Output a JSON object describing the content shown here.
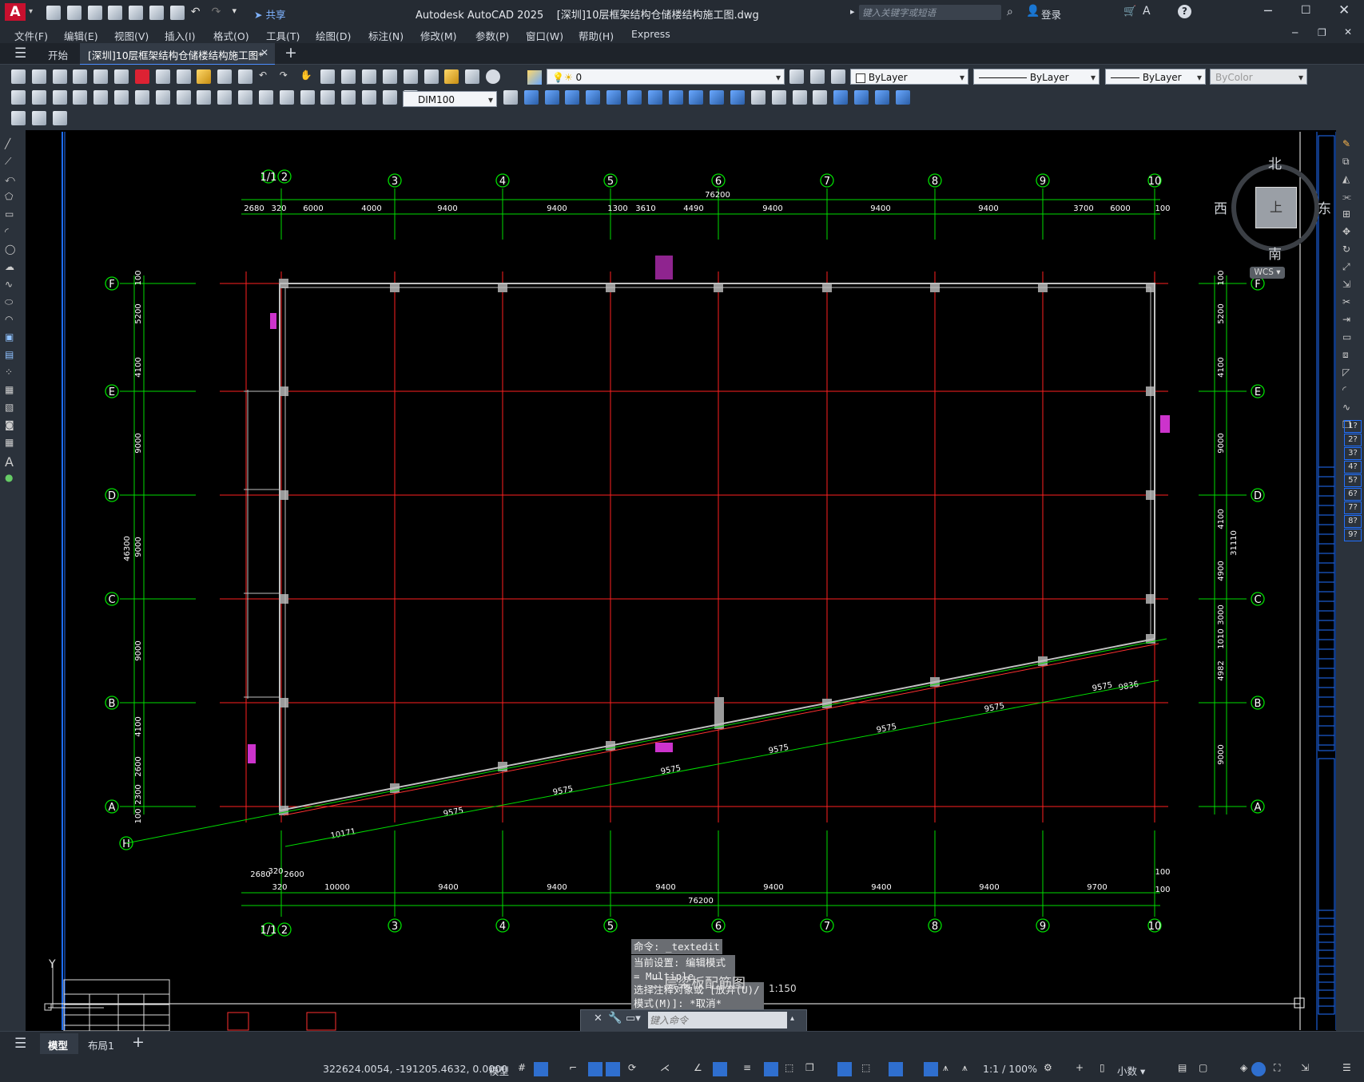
{
  "app": {
    "title": "Autodesk AutoCAD 2025",
    "document": "[深圳]10层框架结构仓储楼结构施工图.dwg",
    "share_label": "共享",
    "search_placeholder": "键入关键字或短语",
    "login_label": "登录"
  },
  "menu": [
    "文件(F)",
    "编辑(E)",
    "视图(V)",
    "插入(I)",
    "格式(O)",
    "工具(T)",
    "绘图(D)",
    "标注(N)",
    "修改(M)",
    "参数(P)",
    "窗口(W)",
    "帮助(H)",
    "Express"
  ],
  "doc_tabs": {
    "start": "开始",
    "active": "[深圳]10层框架结构仓储楼结构施工图*"
  },
  "toolbar": {
    "layer_value": "0",
    "color_value": "ByLayer",
    "linetype_value": "ByLayer",
    "lineweight_value": "ByLayer",
    "plotstyle_value": "ByColor",
    "dimstyle_value": "DIM100"
  },
  "viewcube": {
    "north": "北",
    "south": "南",
    "east": "东",
    "west": "西",
    "wcs": "WCS",
    "top": "上"
  },
  "right_panel_numbers": [
    "1?",
    "2?",
    "3?",
    "4?",
    "5?",
    "6?",
    "7?",
    "8?",
    "9?"
  ],
  "drawing": {
    "cols": [
      "1/1",
      "2",
      "3",
      "4",
      "5",
      "6",
      "7",
      "8",
      "9",
      "10"
    ],
    "rows": [
      "F",
      "E",
      "D",
      "C",
      "B",
      "A"
    ],
    "extra_axis": "H",
    "top_dims": [
      "2680",
      "320",
      "6000",
      "4000",
      "9400",
      "9400",
      "1300",
      "3610",
      "4490",
      "9400",
      "9400",
      "9400",
      "3700",
      "6000",
      "100"
    ],
    "top_total": "76200",
    "bottom_dims": [
      "2680",
      "320",
      "2600",
      "320",
      "10000",
      "9400",
      "9400",
      "9400",
      "9400",
      "9400",
      "9400",
      "9700",
      "100",
      "100"
    ],
    "bottom_total": "76200",
    "left_dims": [
      "100",
      "5200",
      "4100",
      "9000",
      "9000",
      "9000",
      "4100",
      "2600",
      "2300",
      "100"
    ],
    "left_total": "46300",
    "right_dims": [
      "100",
      "5200",
      "4100",
      "9000",
      "4100",
      "4900",
      "3000",
      "1010",
      "4982",
      "9000"
    ],
    "right_total": "31110",
    "sloped_dims": [
      "10171",
      "9575",
      "9575",
      "9575",
      "9575",
      "9575",
      "9575",
      "9575",
      "9836"
    ],
    "title_partial": "二层梁板配筋图",
    "scale_partial": "1:150"
  },
  "command": {
    "line1": "命令: _textedit",
    "line2": "当前设置: 编辑模式 = Multiple",
    "line3": "选择注释对象或 [放弃(U)/模式(M)]: *取消*",
    "placeholder": "键入命令"
  },
  "layout_tabs": [
    "模型",
    "布局1"
  ],
  "status": {
    "coords": "322624.0054, -191205.4632, 0.0000",
    "model": "模型",
    "scale": "1:1 / 100%",
    "units": "小数"
  }
}
